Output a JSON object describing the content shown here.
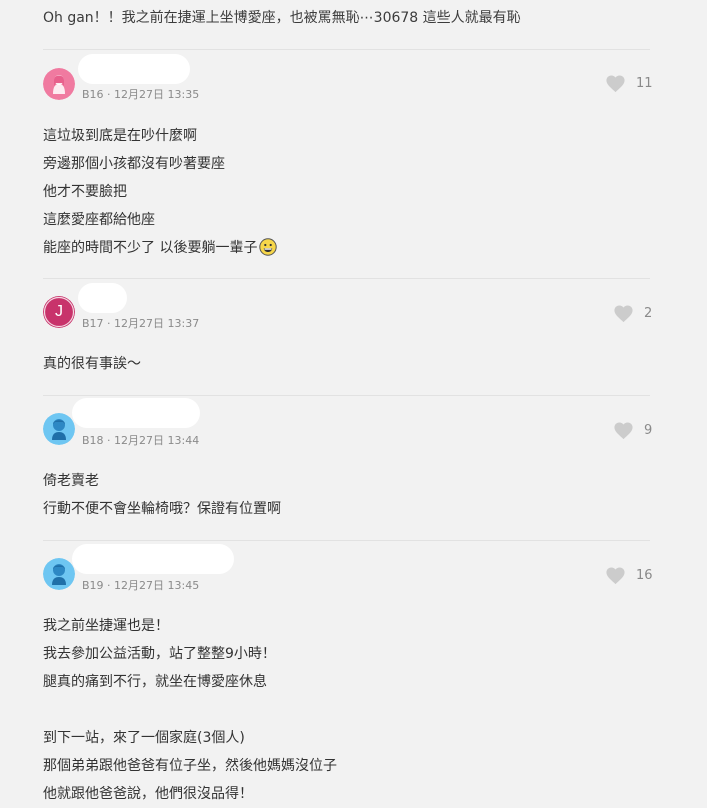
{
  "top_comment": {
    "text": "Oh gan！！我之前在捷運上坐博愛座，也被罵無恥⋯30678 這些人就最有恥"
  },
  "comments": [
    {
      "floor": "B16",
      "date": "12月27日 13:35",
      "likes": "11",
      "avatar_icon": "female-avatar-icon",
      "avatar_color": "#f07aa0",
      "lines": [
        "這垃圾到底是在吵什麼啊",
        "旁邊那個小孩都沒有吵著要座",
        "他才不要臉把",
        "這麼愛座都給他座",
        "能座的時間不少了 以後要躺一輩子"
      ],
      "emoji": "grinning-face-emoji"
    },
    {
      "floor": "B17",
      "date": "12月27日 13:37",
      "likes": "2",
      "avatar_icon": "letter-avatar-icon",
      "avatar_letter": "J",
      "avatar_color": "#c8336b",
      "lines": [
        "真的很有事誒～"
      ]
    },
    {
      "floor": "B18",
      "date": "12月27日 13:44",
      "likes": "9",
      "avatar_icon": "male-avatar-icon",
      "avatar_color": "#6ec6f2",
      "lines": [
        "倚老賣老",
        "行動不便不會坐輪椅哦？保證有位置啊"
      ]
    },
    {
      "floor": "B19",
      "date": "12月27日 13:45",
      "likes": "16",
      "avatar_icon": "male-avatar-icon",
      "avatar_color": "#6ec6f2",
      "lines": [
        "我之前坐捷運也是！",
        "我去參加公益活動，站了整整9小時！",
        "腿真的痛到不行，就坐在博愛座休息",
        "",
        "到下一站，來了一個家庭(3個人)",
        "那個弟弟跟他爸爸有位子坐，然後他媽媽沒位子",
        "他就跟他爸爸說，他們很沒品得！"
      ]
    }
  ],
  "icons": {
    "like": "heart-icon"
  },
  "colors": {
    "background": "#f2f2f2",
    "text": "#333333",
    "meta": "#8a8a8a",
    "heart": "#cccccc"
  }
}
